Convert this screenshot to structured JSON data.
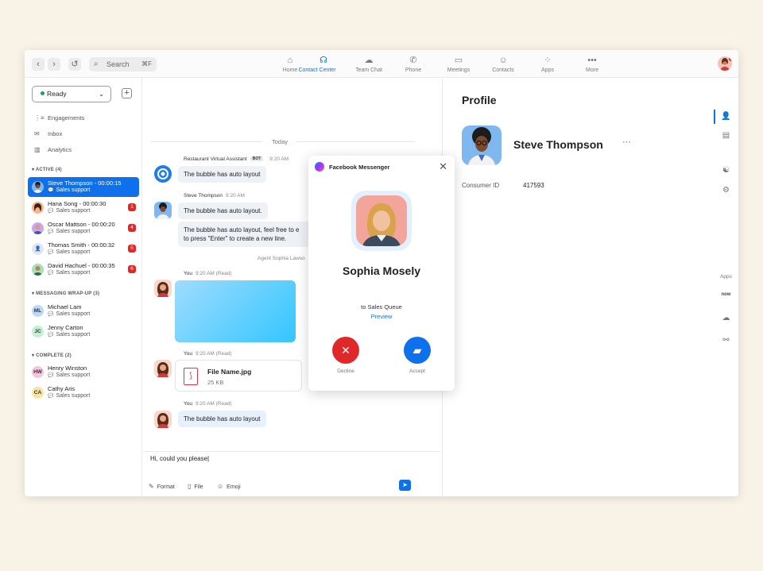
{
  "topbar": {
    "search_placeholder": "Search",
    "search_shortcut": "⌘F",
    "tabs": [
      {
        "label": "Home",
        "icon": "home-icon",
        "glyph": "⌂"
      },
      {
        "label": "Contact Center",
        "icon": "contact-center-icon",
        "glyph": "☊"
      },
      {
        "label": "Team Chat",
        "icon": "team-chat-icon",
        "glyph": "☁"
      },
      {
        "label": "Phone",
        "icon": "phone-icon",
        "glyph": "✆"
      },
      {
        "label": "Meetings",
        "icon": "meetings-icon",
        "glyph": "▭"
      },
      {
        "label": "Contacts",
        "icon": "contacts-icon",
        "glyph": "☺"
      },
      {
        "label": "Apps",
        "icon": "apps-icon",
        "glyph": "⁘"
      },
      {
        "label": "More",
        "icon": "more-icon",
        "glyph": "•••"
      }
    ],
    "active_tab": "Contact Center"
  },
  "sidebar": {
    "status": "Ready",
    "menu": [
      {
        "label": "Engagements",
        "icon": "engagements-icon",
        "glyph": "⋮≡"
      },
      {
        "label": "Inbox",
        "icon": "inbox-icon",
        "glyph": "✉"
      },
      {
        "label": "Analytics",
        "icon": "analytics-icon",
        "glyph": "▥"
      }
    ],
    "sections": {
      "active": "ACTIVE (4)",
      "wrapup": "MESSAGING WRAP-UP (3)",
      "complete": "COMPLETE (2)"
    },
    "active_items": [
      {
        "name": "Steve Thompson - 00:00:15",
        "sub": "Sales support",
        "badge": ""
      },
      {
        "name": "Hana Song - 00:00:30",
        "sub": "Sales support",
        "badge": "1"
      },
      {
        "name": "Oscar Mattson - 00:00:20",
        "sub": "Sales support",
        "badge": "4"
      },
      {
        "name": "Thomas Smith - 00:00:32",
        "sub": "Sales support",
        "badge": "5"
      },
      {
        "name": "David Hachuel - 00:00:35",
        "sub": "Sales support",
        "badge": "6"
      }
    ],
    "wrapup_items": [
      {
        "initials": "ML",
        "name": "Michael Lam",
        "sub": "Sales support"
      },
      {
        "initials": "JC",
        "name": "Jenny Carton",
        "sub": "Sales support"
      }
    ],
    "complete_items": [
      {
        "initials": "HW",
        "name": "Henry Winston",
        "sub": "Sales support"
      },
      {
        "initials": "CA",
        "name": "Cathy Aris",
        "sub": "Sales support"
      }
    ]
  },
  "chat": {
    "date_divider": "Today",
    "msg1": {
      "sender": "Restaurant Virtual Assistant",
      "tag": "BOT",
      "time": "9:20 AM",
      "text": "The bubble has auto layout"
    },
    "msg2": {
      "sender": "Steve Thompson",
      "time": "9:20 AM",
      "text1": "The bubble has auto layout.",
      "text2_line1": "The bubble has auto layout, feel free to e",
      "text2_line2": "to press \"Enter\" to create a new line."
    },
    "agent_note": "Agent Sophia Lawso",
    "you_label": "You",
    "msg3_time": "9:20 AM (Read)",
    "msg4": {
      "time": "9:20 AM (Read)",
      "file_name": "File Name.jpg",
      "file_size": "25 KB"
    },
    "msg5": {
      "time": "9:20 AM (Read)",
      "text": "The bubble has auto layout"
    },
    "input_value": "Hi, could you please|",
    "tools": {
      "format": "Format",
      "file": "File",
      "emoji": "Emoji"
    }
  },
  "profile": {
    "title": "Profile",
    "name": "Steve Thompson",
    "more": "···",
    "field_label": "Consumer ID",
    "field_value": "417593"
  },
  "rail": {
    "apps_label": "Apps",
    "now_label": "now"
  },
  "popup": {
    "title": "Facebook Messenger",
    "caller": "Sophia Mosely",
    "queue": "to Sales Queue",
    "preview": "Preview",
    "decline": "Decline",
    "accept": "Accept"
  },
  "colors": {
    "accent": "#0e71eb",
    "danger": "#e02828",
    "online": "#18a058",
    "background": "#f8f3e6"
  }
}
